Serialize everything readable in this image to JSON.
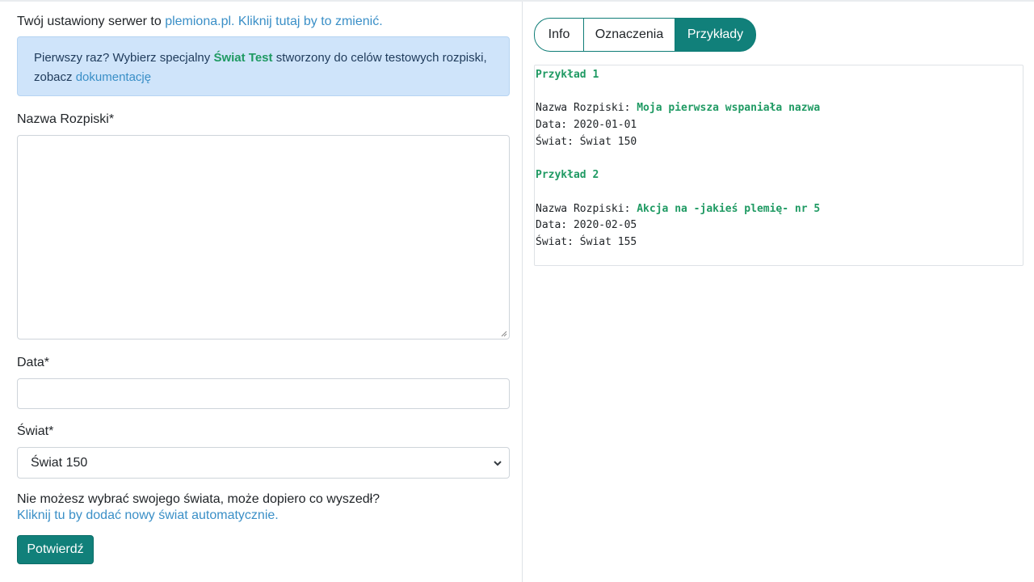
{
  "form": {
    "server_prefix": "Twój ustawiony serwer to",
    "server_name": "plemiona.pl.",
    "server_change": "Kliknij tutaj by to zmienić.",
    "alert_text_1": "Pierwszy raz? Wybierz specjalny",
    "alert_highlight": "Świat Test",
    "alert_text_2": "stworzony do celów testowych rozpiski, zobacz",
    "alert_link": "dokumentację",
    "name_label": "Nazwa Rozpiski*",
    "name_value": "",
    "date_label": "Data*",
    "date_value": "",
    "world_label": "Świat*",
    "world_selected": "Świat 150",
    "help_text": "Nie możesz wybrać swojego świata, może dopiero co wyszedł?",
    "help_link": "Kliknij tu by dodać nowy świat automatycznie.",
    "submit_label": "Potwierdź"
  },
  "tabs": [
    {
      "label": "Info",
      "active": false
    },
    {
      "label": "Oznaczenia",
      "active": false
    },
    {
      "label": "Przykłady",
      "active": true
    }
  ],
  "examples": [
    {
      "title": "Przykład 1",
      "name_key": "Nazwa Rozpiski:",
      "name_value": "Moja pierwsza wspaniała nazwa",
      "date_line": "Data: 2020-01-01",
      "world_line": "Świat: Świat 150"
    },
    {
      "title": "Przykład 2",
      "name_key": "Nazwa Rozpiski:",
      "name_value": "Akcja na -jakieś plemię- nr 5",
      "date_line": "Data: 2020-02-05",
      "world_line": "Świat: Świat 155"
    }
  ],
  "colors": {
    "primary": "#11807a",
    "link": "#3a8fc7",
    "highlight_green": "#1f9a63",
    "alert_bg": "#cfe4fa"
  },
  "icons": {
    "select_arrow": "chevron-down-icon",
    "textarea_grip": "resize-grip-icon"
  }
}
